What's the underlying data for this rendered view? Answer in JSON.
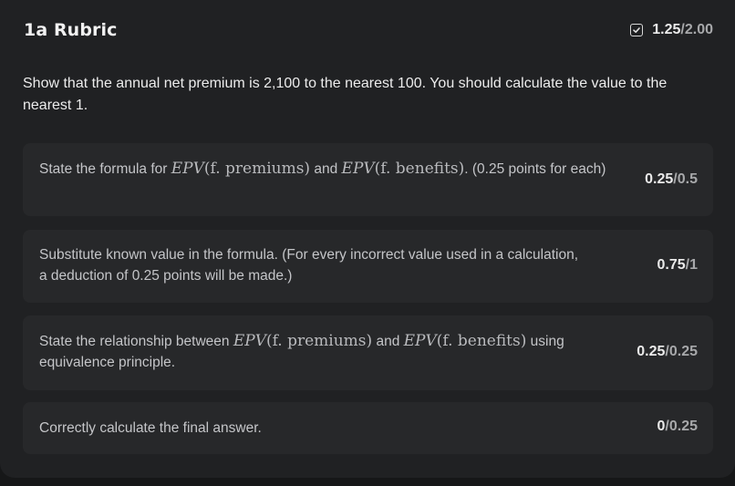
{
  "rubric": {
    "title": "1a Rubric",
    "score_earned": "1.25",
    "score_max": "2.00",
    "score_icon": "checkbox-check-icon"
  },
  "question": "Show that the annual net premium is 2,100 to the nearest 100. You should calculate the value to the nearest 1.",
  "criteria": [
    {
      "pre": "State the formula for ",
      "math1": "EPV(f. premiums)",
      "mid": " and ",
      "math2": "EPV(f. benefits)",
      "post": ". (0.25 points for each)",
      "earned": "0.25",
      "max": "0.5"
    },
    {
      "text": "Substitute known value in the formula. (For every incorrect value used in a calculation, a deduction of 0.25 points will be made.)",
      "earned": "0.75",
      "max": "1"
    },
    {
      "pre": "State the relationship between ",
      "math1": "EPV(f. premiums)",
      "mid": " and ",
      "math2": "EPV(f. benefits)",
      "post": " using equivalence principle.",
      "earned": "0.25",
      "max": "0.25"
    },
    {
      "text": "Correctly calculate the final answer.",
      "earned": "0",
      "max": "0.25"
    }
  ]
}
